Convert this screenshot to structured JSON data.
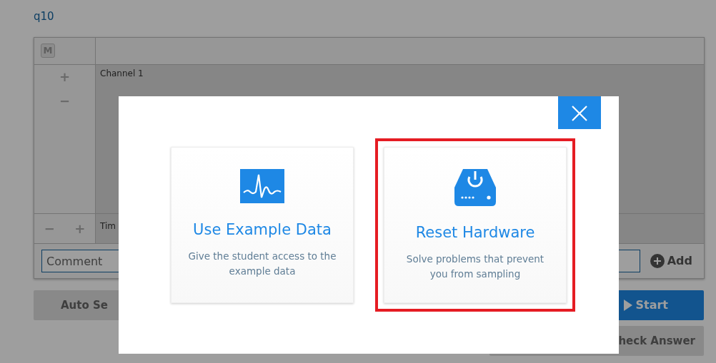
{
  "page": {
    "title": "q10",
    "graph": {
      "mode_label": "M",
      "channel_label": "Channel 1",
      "axis_label": "Tim",
      "zoom_in": "+",
      "zoom_out": "−",
      "time_zoom_out": "−",
      "time_zoom_in": "+"
    },
    "comment": {
      "placeholder": "Comment",
      "add_label": "Add"
    },
    "buttons": [
      {
        "kind": "plain",
        "label": "Auto Se"
      },
      {
        "kind": "primary",
        "label": "Start"
      },
      {
        "kind": "plain",
        "label": "heck Answer"
      }
    ]
  },
  "dialog": {
    "options": [
      {
        "kind": "example",
        "title": "Use Example Data",
        "description": "Give the student access to the example data",
        "highlighted": false
      },
      {
        "kind": "hardware",
        "title": "Reset Hardware",
        "description": "Solve problems that prevent you from sampling",
        "highlighted": true
      }
    ]
  }
}
